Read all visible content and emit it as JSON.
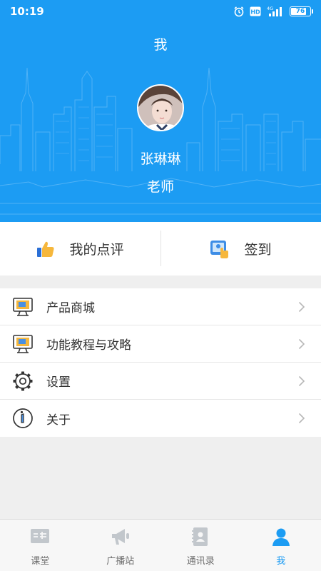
{
  "status_bar": {
    "time": "10:19",
    "network": "4G",
    "hd": "HD",
    "battery": "76",
    "battery_level": 0.76
  },
  "header": {
    "title": "我"
  },
  "profile": {
    "name": "张琳琳",
    "role": "老师"
  },
  "actions": [
    {
      "label": "我的点评",
      "icon": "thumbs-up-icon"
    },
    {
      "label": "签到",
      "icon": "check-in-icon"
    }
  ],
  "menu": [
    {
      "label": "产品商城",
      "icon": "monitor-icon"
    },
    {
      "label": "功能教程与攻略",
      "icon": "monitor-icon"
    },
    {
      "label": "设置",
      "icon": "gear-icon"
    },
    {
      "label": "关于",
      "icon": "info-icon"
    }
  ],
  "tabs": [
    {
      "label": "课堂",
      "icon": "classroom-icon",
      "active": false
    },
    {
      "label": "广播站",
      "icon": "megaphone-icon",
      "active": false
    },
    {
      "label": "通讯录",
      "icon": "contacts-icon",
      "active": false
    },
    {
      "label": "我",
      "icon": "user-icon",
      "active": true
    }
  ],
  "colors": {
    "primary": "#1c9cf3",
    "background": "#efefef",
    "text": "#333333",
    "tab_inactive": "#6e6e6e"
  }
}
